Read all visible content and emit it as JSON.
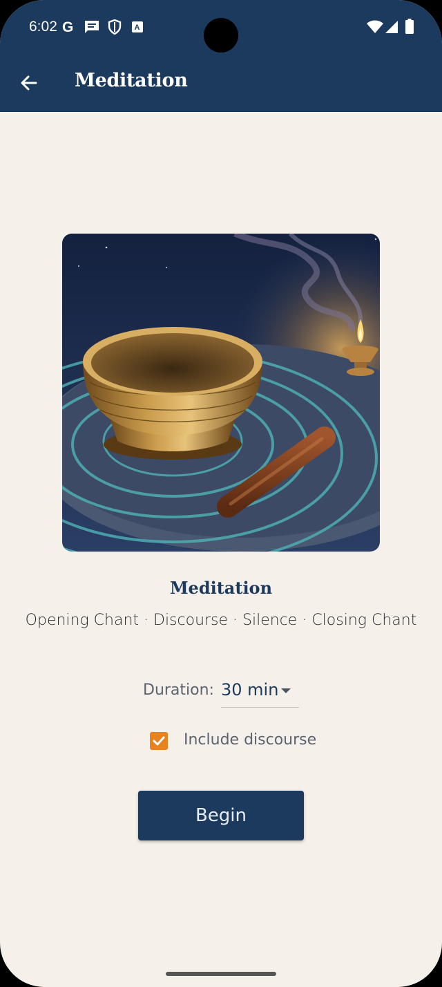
{
  "status_bar": {
    "time": "6:02",
    "notification_icons": [
      "google-icon",
      "message-icon",
      "shield-icon",
      "translate-icon"
    ],
    "system_icons": [
      "wifi-icon",
      "signal-icon",
      "battery-icon"
    ]
  },
  "toolbar": {
    "title": "Meditation",
    "back_icon": "arrow-left-icon",
    "background": "#1c3a5e"
  },
  "session": {
    "title": "Meditation",
    "parts": "Opening Chant · Discourse · Silence · Closing Chant"
  },
  "duration": {
    "label": "Duration:",
    "value": "30 min"
  },
  "discourse_option": {
    "label": "Include discourse",
    "checked": true,
    "color": "#e8821f"
  },
  "begin_button": {
    "label": "Begin"
  },
  "colors": {
    "primary": "#1c3a5e",
    "background": "#f5f0e9",
    "accent": "#e8821f"
  }
}
